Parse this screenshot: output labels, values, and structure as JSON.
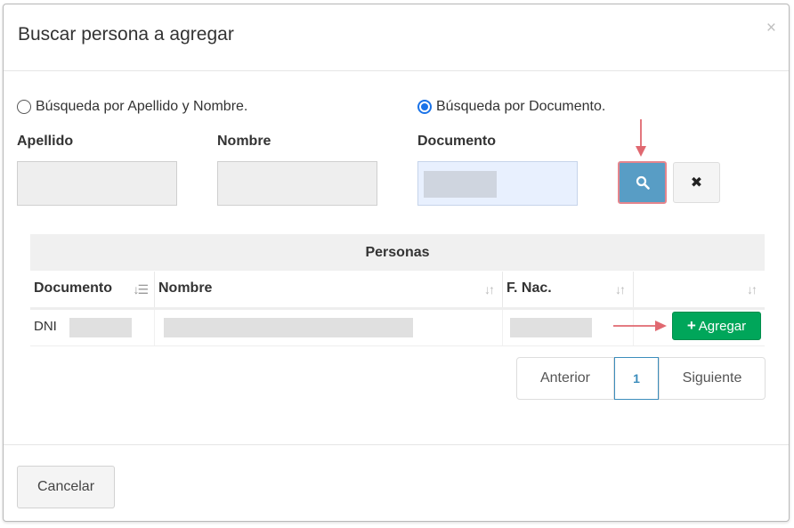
{
  "modal": {
    "title": "Buscar persona a agregar",
    "close_glyph": "×"
  },
  "search_mode": {
    "option_name": "Búsqueda por Apellido y Nombre.",
    "option_document": "Búsqueda por Documento.",
    "selected": "document"
  },
  "fields": {
    "apellido_label": "Apellido",
    "nombre_label": "Nombre",
    "documento_label": "Documento",
    "apellido_value": "",
    "nombre_value": "",
    "documento_value": ""
  },
  "buttons": {
    "search_icon": "search-icon",
    "clear_icon": "times-icon",
    "clear_glyph": "✖",
    "add_label": "Agregar",
    "add_glyph": "+",
    "cancel_label": "Cancelar"
  },
  "table": {
    "title": "Personas",
    "columns": [
      "Documento",
      "Nombre",
      "F. Nac.",
      ""
    ],
    "rows": [
      {
        "documento": "DNI",
        "nombre": "",
        "fnac": ""
      }
    ]
  },
  "pagination": {
    "prev_label": "Anterior",
    "current_page": "1",
    "next_label": "Siguiente"
  },
  "colors": {
    "primary": "#3c8dbc",
    "success": "#00a65a",
    "annotation_arrow": "#e06870",
    "radio_accent": "#1a73e8"
  }
}
